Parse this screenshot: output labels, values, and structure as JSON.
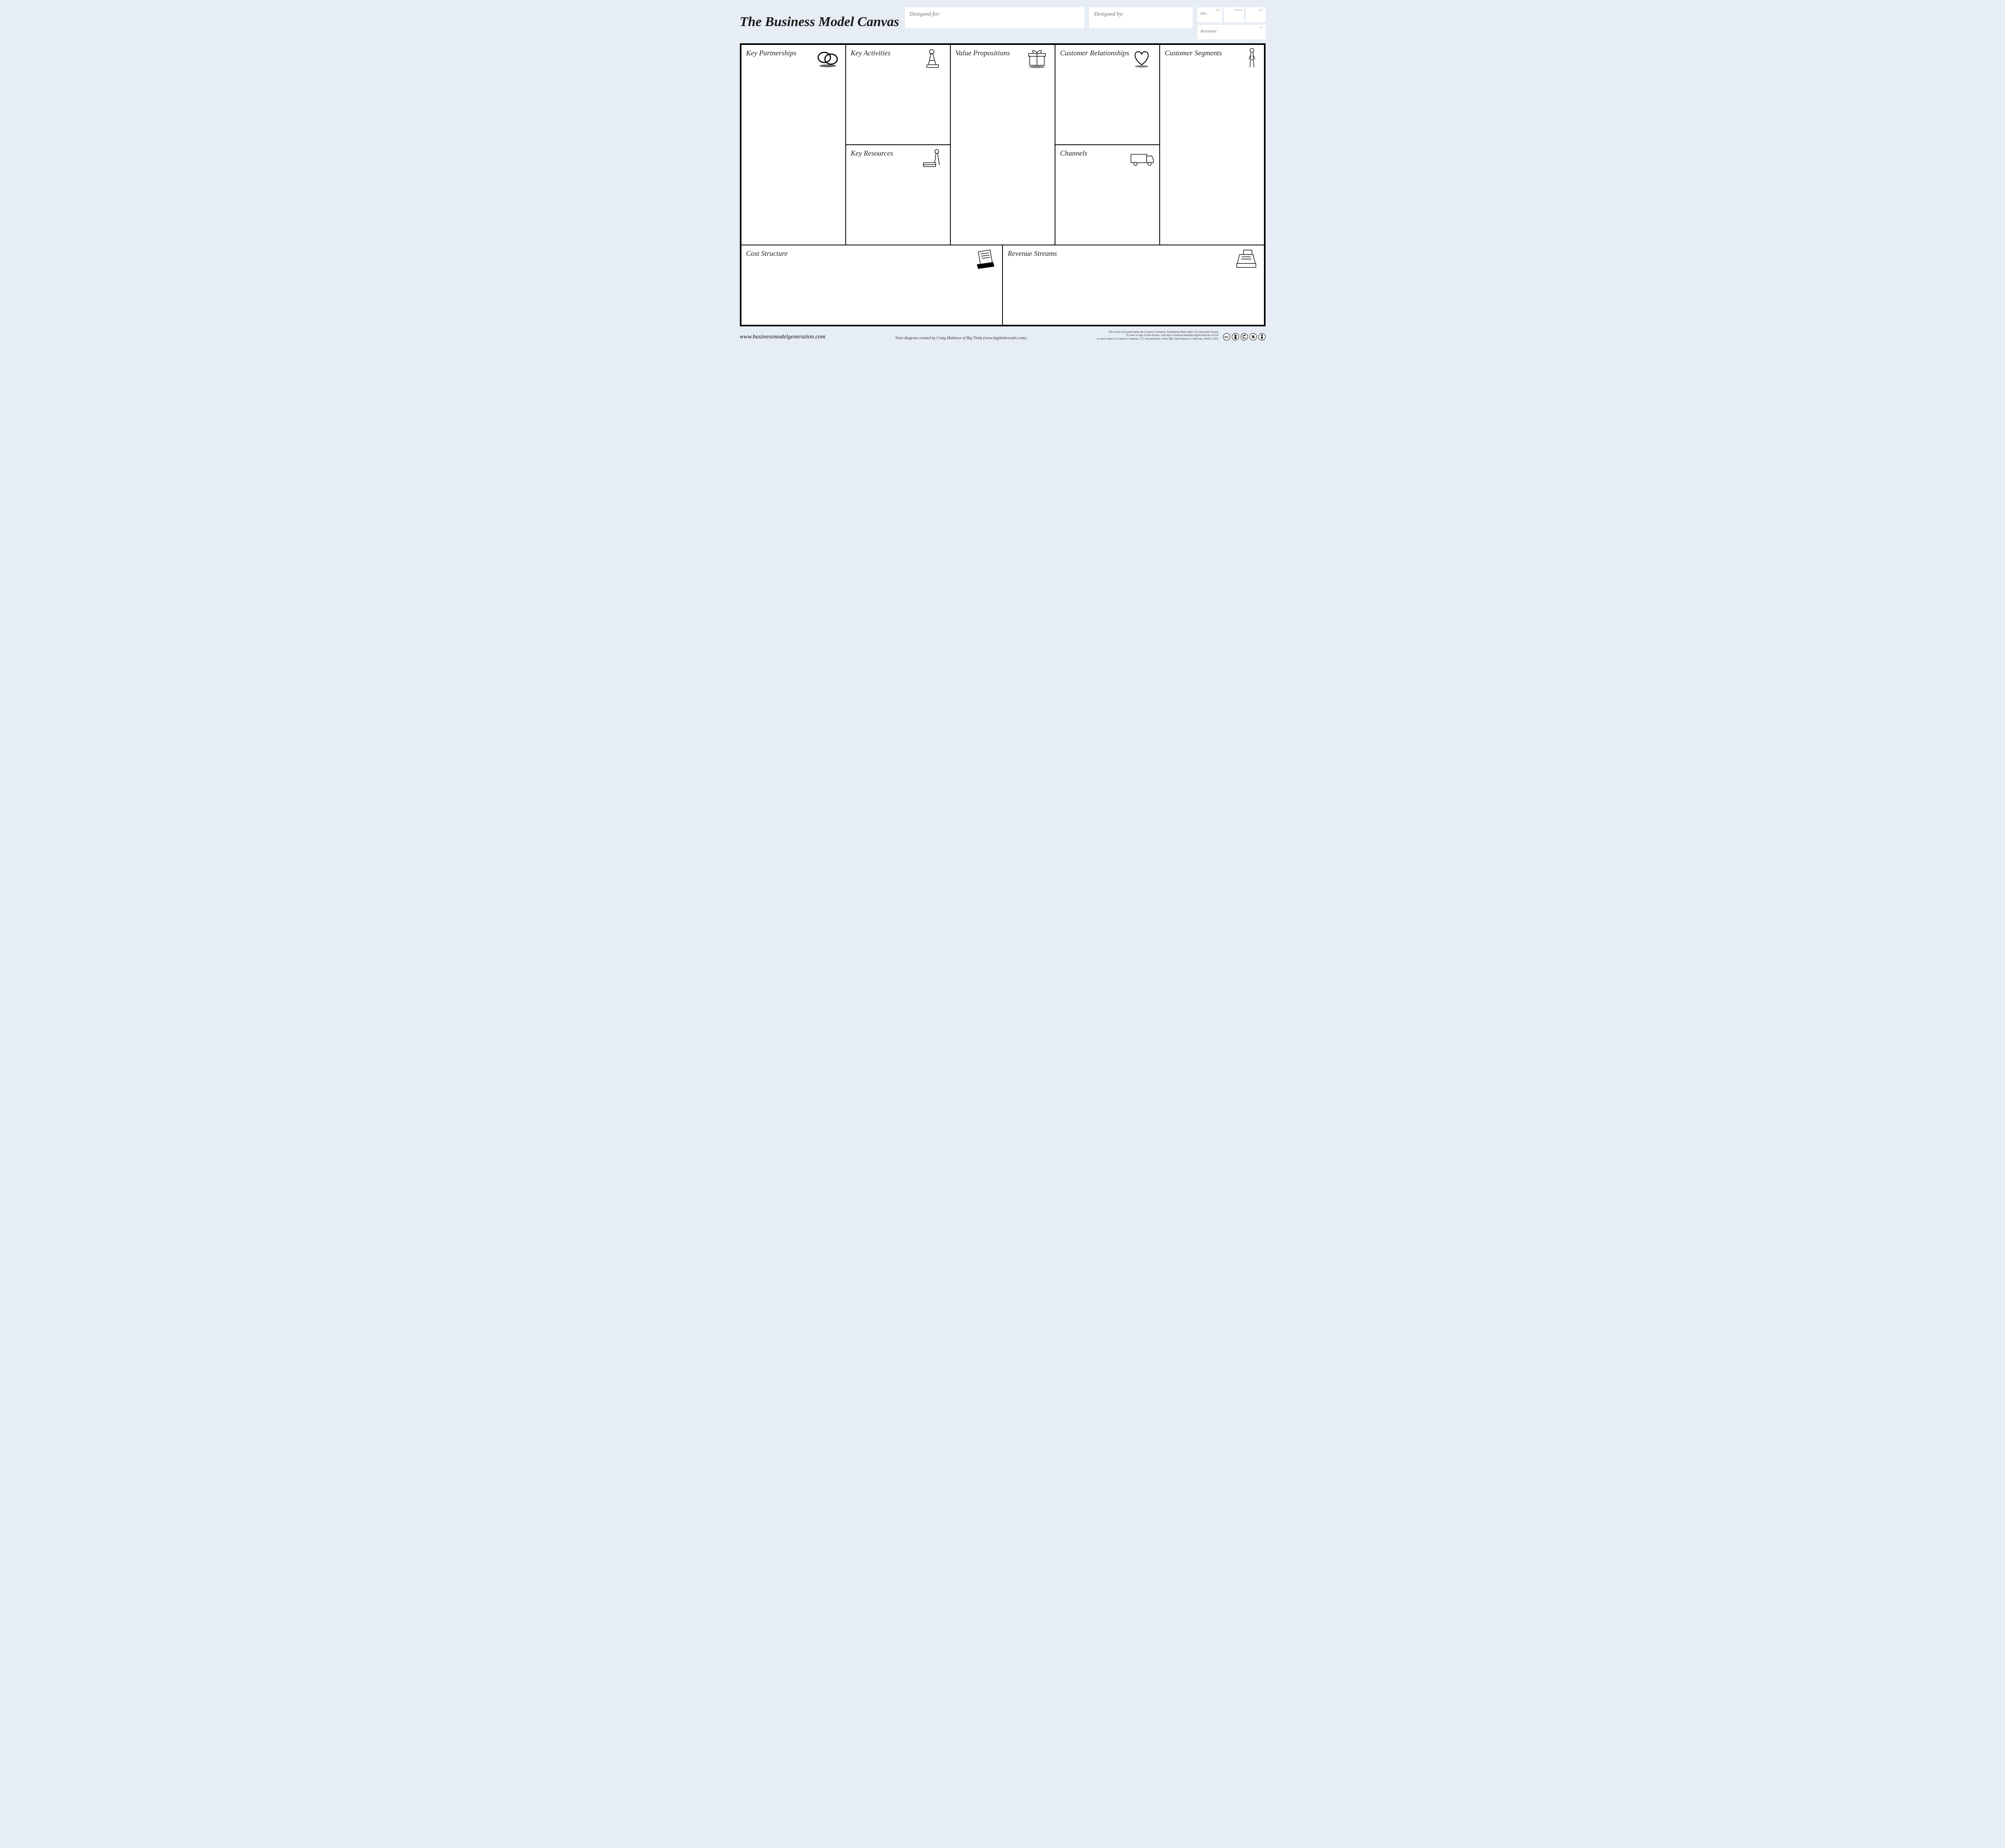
{
  "header": {
    "title": "The Business Model Canvas",
    "designed_for_label": "Designed for:",
    "designed_by_label": "Designed by:",
    "on_label": "On:",
    "on_hints": {
      "day": "Day",
      "month": "Month",
      "year": "Year"
    },
    "iteration_label": "Iteration:",
    "iteration_hint": "No."
  },
  "blocks": {
    "key_partnerships": "Key Partnerships",
    "key_activities": "Key Activities",
    "key_resources": "Key Resources",
    "value_propositions": "Value Propositions",
    "customer_relationships": "Customer Relationships",
    "channels": "Channels",
    "customer_segments": "Customer Segments",
    "cost_structure": "Cost Structure",
    "revenue_streams": "Revenue Streams"
  },
  "footer": {
    "url": "www.businessmodelgeneration.com",
    "credit": "Visio diagram created by Craig Mathews of Big Think (www.bigthinkresults.com).",
    "license_line1": "This work is licensed under the Creative Commons Attribution-Share Alike 3.0 Unported License.",
    "license_line2": "To view a copy of this license, visit http://creativecommons.org/licenses/by-sa/3.0/",
    "license_line3": "or send a letter to Creative Commons, 171 Second Street, Suite 300, San Francisco, California, 94105, USA."
  },
  "cc_badges": [
    "cc",
    "by",
    "sa",
    "remix",
    "person"
  ]
}
